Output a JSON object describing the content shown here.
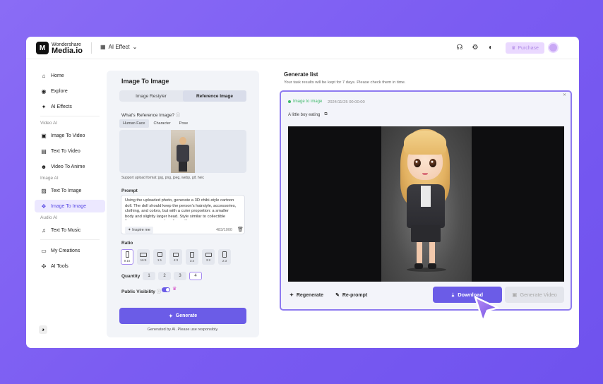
{
  "topbar": {
    "brand_line1": "Wondershare",
    "brand_line2": "Media.io",
    "logo_letter": "M",
    "ai_effect": "AI Effect",
    "purchase": "Purchase"
  },
  "sidebar": {
    "items": [
      {
        "label": "Home",
        "icon": "home-icon"
      },
      {
        "label": "Explore",
        "icon": "explore-icon"
      },
      {
        "label": "AI Effects",
        "icon": "sparkle-icon"
      }
    ],
    "video_section": "Video AI",
    "video_items": [
      "Image To Video",
      "Text To Video",
      "Video To Anime"
    ],
    "image_section": "Image AI",
    "image_items": [
      "Text To Image",
      "Image To Image"
    ],
    "audio_section": "Audio AI",
    "audio_items": [
      "Text To Music"
    ],
    "bottom_items": [
      "My Creations",
      "AI Tools"
    ]
  },
  "panel": {
    "title": "Image To Image",
    "tabs": [
      "Image Restyler",
      "Reference Image"
    ],
    "reference_label": "What's Reference Image?",
    "subtabs": [
      "Human Face",
      "Character",
      "Pose"
    ],
    "support": "Support upload format: jpg, png, jpeg, webp, gif, heic",
    "prompt_label": "Prompt",
    "prompt_text": "Using the uploaded photo, generate a 3D chibi-style cartoon doll. The doll should keep the person's hairstyle, accessories, clothing, and colors, but with a cuter proportion: a smaller body and slightly larger head. Style similar to collectible figures or anime merchandise, with a",
    "inspire": "Inspire me",
    "counter": "483/1000",
    "ratio_label": "Ratio",
    "ratios": [
      "9:16",
      "16:9",
      "1:1",
      "4:3",
      "3:4",
      "3:2",
      "2:3"
    ],
    "quantity_label": "Quantity",
    "quantities": [
      "1",
      "2",
      "3",
      "4"
    ],
    "visibility_label": "Public Visibility",
    "generate": "Generate",
    "generated_by": "Generated by AI. Please use responsibly."
  },
  "results": {
    "title": "Generate list",
    "subtitle": "Your task results will be kept for 7 days. Please check them in time.",
    "tag": "Image to image",
    "date": "2024/11/25  00:00:00",
    "desc": "A little boy eating",
    "regenerate": "Regenerate",
    "reprompt": "Re-prompt",
    "download": "Download",
    "generate_video": "Generate Video"
  },
  "colors": {
    "accent": "#6b5ce7",
    "success": "#3fb96a"
  }
}
